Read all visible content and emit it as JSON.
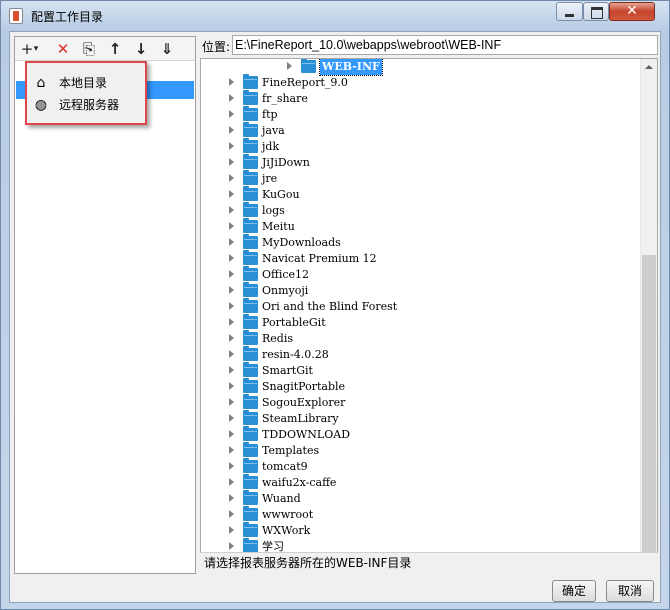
{
  "window": {
    "title": "配置工作目录"
  },
  "toolbar": {
    "add": "+",
    "add_arrow": "▾",
    "delete": "✕",
    "copy": "⎘",
    "up": "↑",
    "down": "↓",
    "sort": "⇓"
  },
  "menu": {
    "items": [
      {
        "label": "本地目录",
        "icon": "house-icon"
      },
      {
        "label": "远程服务器",
        "icon": "globe-icon"
      }
    ]
  },
  "location": {
    "label": "位置:",
    "value": "E:\\FineReport_10.0\\webapps\\webroot\\WEB-INF"
  },
  "tree": {
    "selected": "WEB-INF",
    "folders": [
      "FineReport_9.0",
      "fr_share",
      "ftp",
      "java",
      "jdk",
      "JiJiDown",
      "jre",
      "KuGou",
      "logs",
      "Meitu",
      "MyDownloads",
      "Navicat Premium 12",
      "Office12",
      "Onmyoji",
      "Ori and the Blind Forest",
      "PortableGit",
      "Redis",
      "resin-4.0.28",
      "SmartGit",
      "SnagitPortable",
      "SogouExplorer",
      "SteamLibrary",
      "TDDOWNLOAD",
      "Templates",
      "tomcat9",
      "waifu2x-caffe",
      "Wuand",
      "wwwroot",
      "WXWork",
      "学习"
    ]
  },
  "status": "请选择报表服务器所在的WEB-INF目录",
  "buttons": {
    "ok": "确定",
    "cancel": "取消"
  }
}
